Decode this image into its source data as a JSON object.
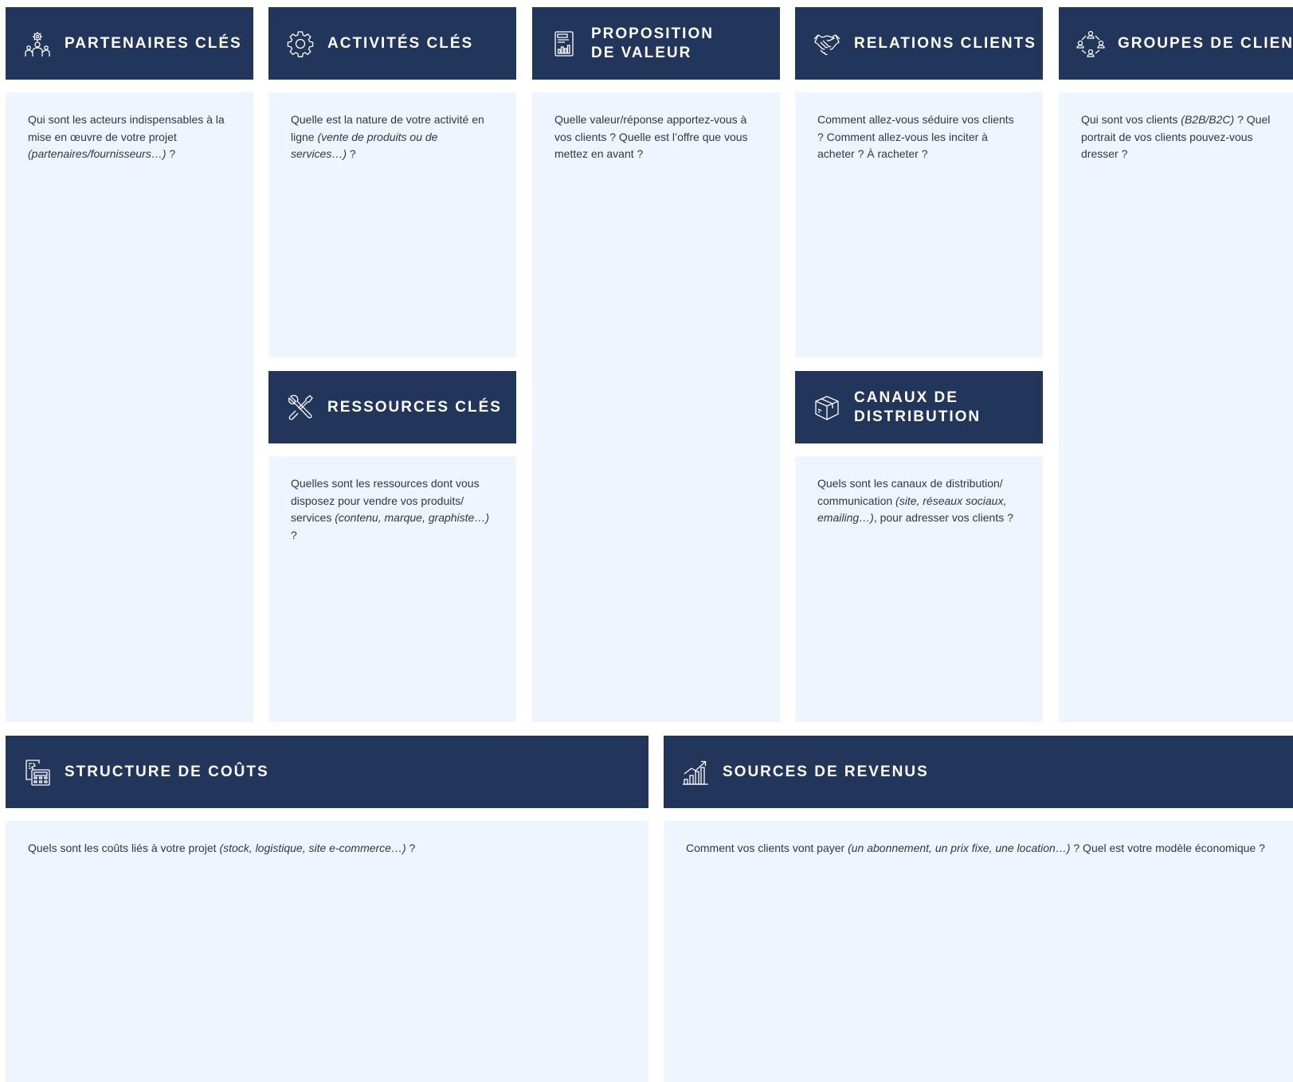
{
  "colors": {
    "header_bg": "#22355a",
    "header_text": "#ffffff",
    "card_bg": "#eff5fe",
    "card_text": "#2c3848"
  },
  "partenaires": {
    "icon": "partners-icon",
    "title": "PARTENAIRES CLÉS",
    "text_1": "Qui sont les acteurs indispensables à la mise en œuvre de votre projet ",
    "text_em": "(partenaires/fournisseurs…)",
    "text_2": " ?"
  },
  "activites": {
    "icon": "gear-icon",
    "title": "ACTIVITÉS CLÉS",
    "text_1": "Quelle est la nature de votre activité en ligne ",
    "text_em": "(vente de produits ou de services…)",
    "text_2": " ?"
  },
  "ressources": {
    "icon": "tools-icon",
    "title": "RESSOURCES CLÉS",
    "text_1": "Quelles sont les ressources dont vous disposez pour vendre vos produits/ services ",
    "text_em": "(contenu, marque, graphiste…)",
    "text_2": " ?"
  },
  "proposition": {
    "icon": "document-chart-icon",
    "title_line1": "PROPOSITION",
    "title_line2": "DE VALEUR",
    "text": "Quelle valeur/réponse apportez-vous à vos clients ? Quelle est l’offre que vous mettez en avant ?"
  },
  "relations": {
    "icon": "handshake-icon",
    "title": "RELATIONS CLIENTS",
    "text": "Comment allez-vous séduire vos clients ? Comment allez-vous les inciter à acheter ? À racheter ?"
  },
  "canaux": {
    "icon": "box-icon",
    "title_line1": "CANAUX DE",
    "title_line2": "DISTRIBUTION",
    "text_1": "Quels sont les canaux de distribution/ communication ",
    "text_em": "(site, réseaux sociaux, emailing…)",
    "text_2": ", pour adresser vos clients ?"
  },
  "groupes": {
    "icon": "customer-network-icon",
    "title": "GROUPES DE CLIENTS",
    "text_1": "Qui sont vos clients ",
    "text_em": "(B2B/B2C)",
    "text_2": " ? Quel portrait de vos clients pouvez-vous dresser ?"
  },
  "couts": {
    "icon": "calculator-icon",
    "title": "STRUCTURE DE COÛTS",
    "text_1": "Quels sont les coûts liés à votre projet ",
    "text_em": "(stock, logistique, site e-commerce…)",
    "text_2": " ?"
  },
  "revenus": {
    "icon": "growth-chart-icon",
    "title": "SOURCES DE REVENUS",
    "text_1": "Comment vos clients vont payer ",
    "text_em": "(un abonnement, un prix fixe, une location…)",
    "text_2": " ? Quel est votre modèle économique ?"
  }
}
